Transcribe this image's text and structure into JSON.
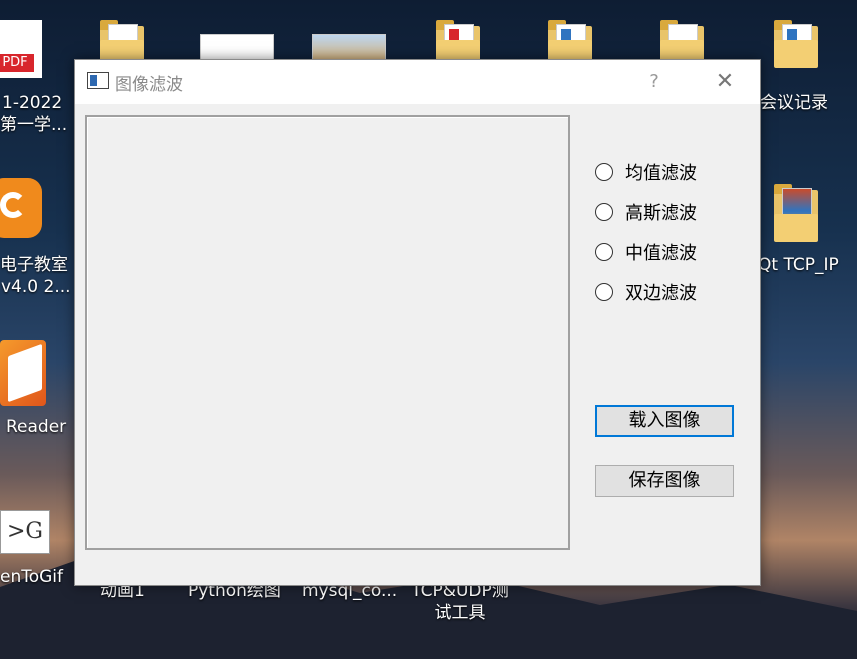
{
  "desktop": {
    "left_icons": [
      {
        "label_lines": [
          "1-2022",
          "第一学..."
        ]
      },
      {
        "label_lines": [
          "电子教室",
          "v4.0 2..."
        ]
      },
      {
        "label_lines": [
          "Reader"
        ]
      },
      {
        "label_lines": [
          "enToGif"
        ]
      }
    ],
    "pdf_badge": "PDF",
    "gif_badge": ">G",
    "right_icons": [
      {
        "label": "会议记录"
      },
      {
        "label": "Qt TCP_IP"
      }
    ],
    "bottom_icons": [
      {
        "label": "动画1"
      },
      {
        "label": "Python绘图"
      },
      {
        "label": "mysql_co..."
      },
      {
        "label_lines": [
          "TCP&UDP测",
          "试工具"
        ]
      }
    ]
  },
  "window": {
    "title": "图像滤波",
    "help_glyph": "?",
    "close_glyph": "✕",
    "filters": [
      {
        "label": "均值滤波",
        "checked": false
      },
      {
        "label": "高斯滤波",
        "checked": false
      },
      {
        "label": "中值滤波",
        "checked": false
      },
      {
        "label": "双边滤波",
        "checked": false
      }
    ],
    "load_button": "载入图像",
    "save_button": "保存图像"
  },
  "colors": {
    "focus_border": "#0078d7",
    "title_text": "#8a8a8a"
  }
}
